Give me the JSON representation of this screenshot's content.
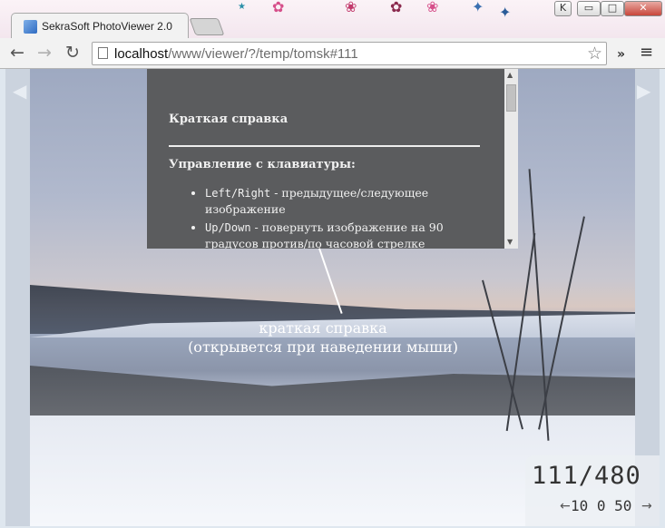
{
  "browser": {
    "tab_title": "SekraSoft PhotoViewer 2.0",
    "url_host": "localhost",
    "url_path": "/www/viewer/?/temp/tomsk#111",
    "window_buttons": [
      "K",
      "▭",
      "□",
      "✕"
    ]
  },
  "icons": {
    "back": "back-arrow-icon",
    "forward": "forward-arrow-icon",
    "reload": "reload-icon",
    "star": "star-icon",
    "extensions": "chevron-icon",
    "menu": "menu-icon"
  },
  "help": {
    "title": "Краткая справка",
    "subtitle": "Управление с клавиатуры:",
    "items": [
      {
        "key": "Left/Right",
        "text": " - предыдущее/следующее изображение"
      },
      {
        "key": "Up/Down",
        "text": " - повернуть изображение на 90 градусов против/по часовой стрелке"
      }
    ]
  },
  "caption": {
    "line1": "краткая справка",
    "line2": "(открывется при наведении мыши)"
  },
  "counter": {
    "current": "111/480",
    "zoom": "10 0 50"
  }
}
